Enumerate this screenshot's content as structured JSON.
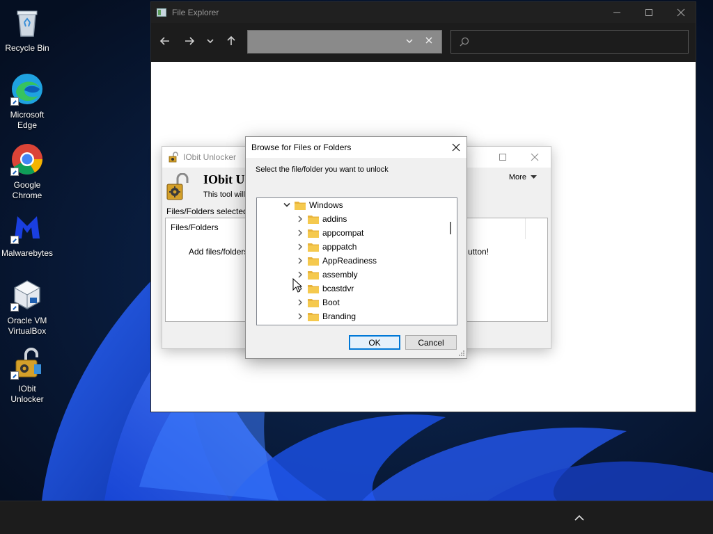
{
  "desktop": {
    "icons": [
      {
        "label": "Recycle Bin",
        "icon": "recycle-bin-icon"
      },
      {
        "label": "Microsoft Edge",
        "icon": "edge-icon"
      },
      {
        "label": "Google Chrome",
        "icon": "chrome-icon"
      },
      {
        "label": "Malwarebytes",
        "icon": "malwarebytes-icon"
      },
      {
        "label": "Oracle VM VirtualBox",
        "icon": "virtualbox-icon"
      },
      {
        "label": "IObit Unlocker",
        "icon": "iobit-unlocker-icon"
      }
    ]
  },
  "explorer": {
    "title": "File Explorer",
    "address_value": "",
    "search_placeholder": ""
  },
  "iobit": {
    "title": "IObit Unlocker",
    "app_name": "IObit Un",
    "description": "This tool will h",
    "more_label": "More",
    "selected_label": "Files/Folders selected",
    "column_header": "Files/Folders",
    "hint_left": "Add files/folders t",
    "hint_right": "utton!"
  },
  "browse": {
    "title": "Browse for Files or Folders",
    "instruction": "Select the file/folder you want to unlock",
    "tree": {
      "root": "Windows",
      "children": [
        "addins",
        "appcompat",
        "apppatch",
        "AppReadiness",
        "assembly",
        "bcastdvr",
        "Boot",
        "Branding"
      ]
    },
    "ok_label": "OK",
    "cancel_label": "Cancel"
  },
  "colors": {
    "accent": "#0078d7",
    "folder": "#f3c34a",
    "taskbar": "#1c1c1c",
    "titlebar_dark": "#202020"
  }
}
